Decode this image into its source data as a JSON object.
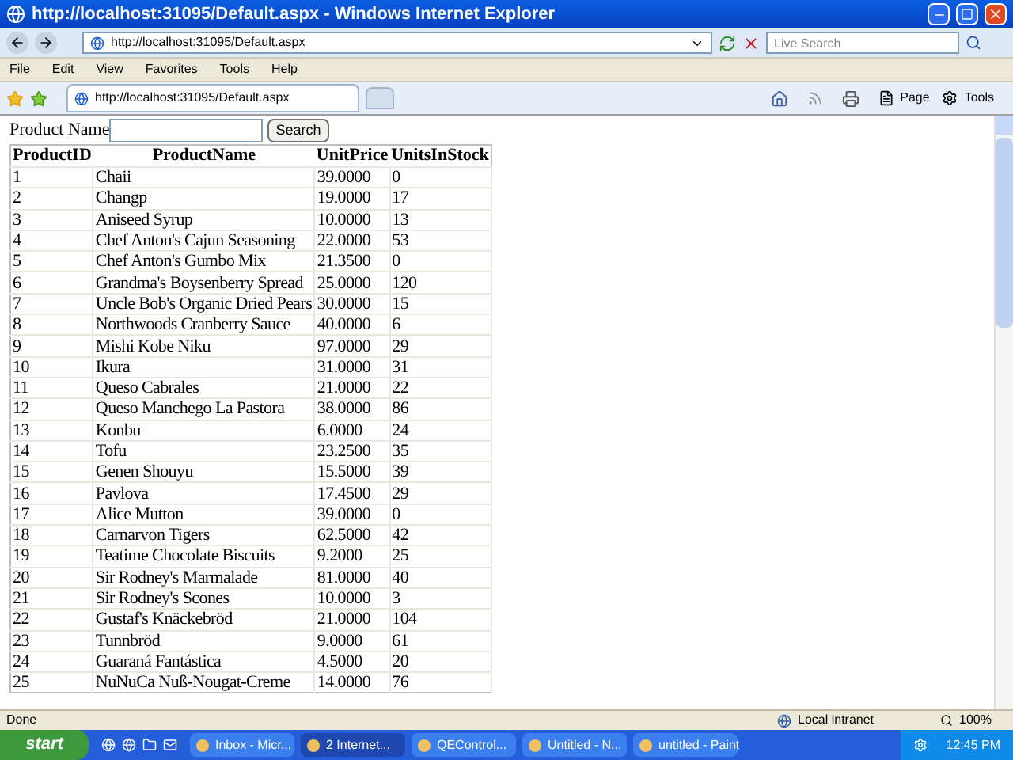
{
  "window": {
    "title": "http://localhost:31095/Default.aspx - Windows Internet Explorer"
  },
  "address_bar": {
    "url": "http://localhost:31095/Default.aspx",
    "search_placeholder": "Live Search"
  },
  "menu": [
    "File",
    "Edit",
    "View",
    "Favorites",
    "Tools",
    "Help"
  ],
  "tabs": [
    {
      "label": "http://localhost:31095/Default.aspx",
      "selected": true
    }
  ],
  "command_bar": [
    "Page",
    "Tools"
  ],
  "page": {
    "search_label": "Product Name",
    "search_button": "Search",
    "table": {
      "columns": [
        "ProductID",
        "ProductName",
        "UnitPrice",
        "UnitsInStock"
      ],
      "rows": [
        [
          "1",
          "Chaii",
          "39.0000",
          "0"
        ],
        [
          "2",
          "Changp",
          "19.0000",
          "17"
        ],
        [
          "3",
          "Aniseed Syrup",
          "10.0000",
          "13"
        ],
        [
          "4",
          "Chef Anton's Cajun Seasoning",
          "22.0000",
          "53"
        ],
        [
          "5",
          "Chef Anton's Gumbo Mix",
          "21.3500",
          "0"
        ],
        [
          "6",
          "Grandma's Boysenberry Spread",
          "25.0000",
          "120"
        ],
        [
          "7",
          "Uncle Bob's Organic Dried Pears",
          "30.0000",
          "15"
        ],
        [
          "8",
          "Northwoods Cranberry Sauce",
          "40.0000",
          "6"
        ],
        [
          "9",
          "Mishi Kobe Niku",
          "97.0000",
          "29"
        ],
        [
          "10",
          "Ikura",
          "31.0000",
          "31"
        ],
        [
          "11",
          "Queso Cabrales",
          "21.0000",
          "22"
        ],
        [
          "12",
          "Queso Manchego La Pastora",
          "38.0000",
          "86"
        ],
        [
          "13",
          "Konbu",
          "6.0000",
          "24"
        ],
        [
          "14",
          "Tofu",
          "23.2500",
          "35"
        ],
        [
          "15",
          "Genen Shouyu",
          "15.5000",
          "39"
        ],
        [
          "16",
          "Pavlova",
          "17.4500",
          "29"
        ],
        [
          "17",
          "Alice Mutton",
          "39.0000",
          "0"
        ],
        [
          "18",
          "Carnarvon Tigers",
          "62.5000",
          "42"
        ],
        [
          "19",
          "Teatime Chocolate Biscuits",
          "9.2000",
          "25"
        ],
        [
          "20",
          "Sir Rodney's Marmalade",
          "81.0000",
          "40"
        ],
        [
          "21",
          "Sir Rodney's Scones",
          "10.0000",
          "3"
        ],
        [
          "22",
          "Gustaf's Knäckebröd",
          "21.0000",
          "104"
        ],
        [
          "23",
          "Tunnbröd",
          "9.0000",
          "61"
        ],
        [
          "24",
          "Guaraná Fantástica",
          "4.5000",
          "20"
        ],
        [
          "25",
          "NuNuCa Nuß-Nougat-Creme",
          "14.0000",
          "76"
        ]
      ]
    }
  },
  "status_bar": {
    "text": "Done",
    "zone": "Local intranet",
    "zoom": "100%"
  },
  "taskbar": {
    "start": "start",
    "tasks": [
      {
        "label": "Inbox - Micr...",
        "selected": false
      },
      {
        "label": "2 Internet...",
        "selected": true
      },
      {
        "label": "QEControl...",
        "selected": false
      },
      {
        "label": "Untitled - N...",
        "selected": false
      },
      {
        "label": "untitled - Paint",
        "selected": false
      }
    ],
    "clock": "12:45 PM"
  }
}
